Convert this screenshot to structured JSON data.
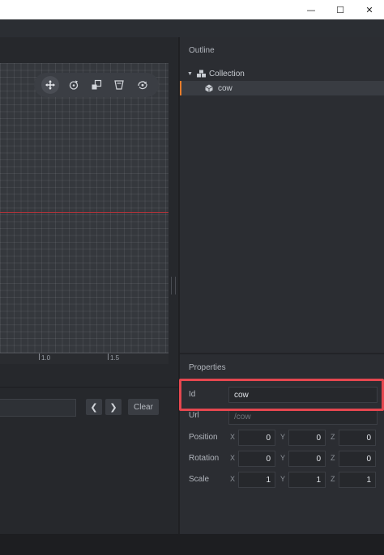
{
  "window": {
    "minimize_glyph": "—",
    "maximize_glyph": "☐",
    "close_glyph": "✕"
  },
  "viewport": {
    "ruler_labels": [
      "1.0",
      "1.5"
    ],
    "tools": [
      "move-tool-icon",
      "rotate-tool-icon",
      "scale-tool-icon",
      "perspective-icon",
      "camera-icon"
    ]
  },
  "console": {
    "prev_label": "❮",
    "next_label": "❯",
    "clear_label": "Clear"
  },
  "outline": {
    "title": "Outline",
    "items": [
      {
        "label": "Collection",
        "icon": "collection-icon",
        "expanded": true
      },
      {
        "label": "cow",
        "icon": "game-object-icon",
        "selected": true
      }
    ]
  },
  "properties": {
    "title": "Properties",
    "id_label": "Id",
    "id_value": "cow",
    "url_label": "Url",
    "url_placeholder": "/cow",
    "axis_x": "X",
    "axis_y": "Y",
    "axis_z": "Z",
    "position_label": "Position",
    "position": [
      "0",
      "0",
      "0"
    ],
    "rotation_label": "Rotation",
    "rotation": [
      "0",
      "0",
      "0"
    ],
    "scale_label": "Scale",
    "scale": [
      "1",
      "1",
      "1"
    ]
  },
  "colors": {
    "highlight": "#e5474f",
    "selection_accent": "#e87c2a",
    "x_axis_line": "#b3333a"
  }
}
